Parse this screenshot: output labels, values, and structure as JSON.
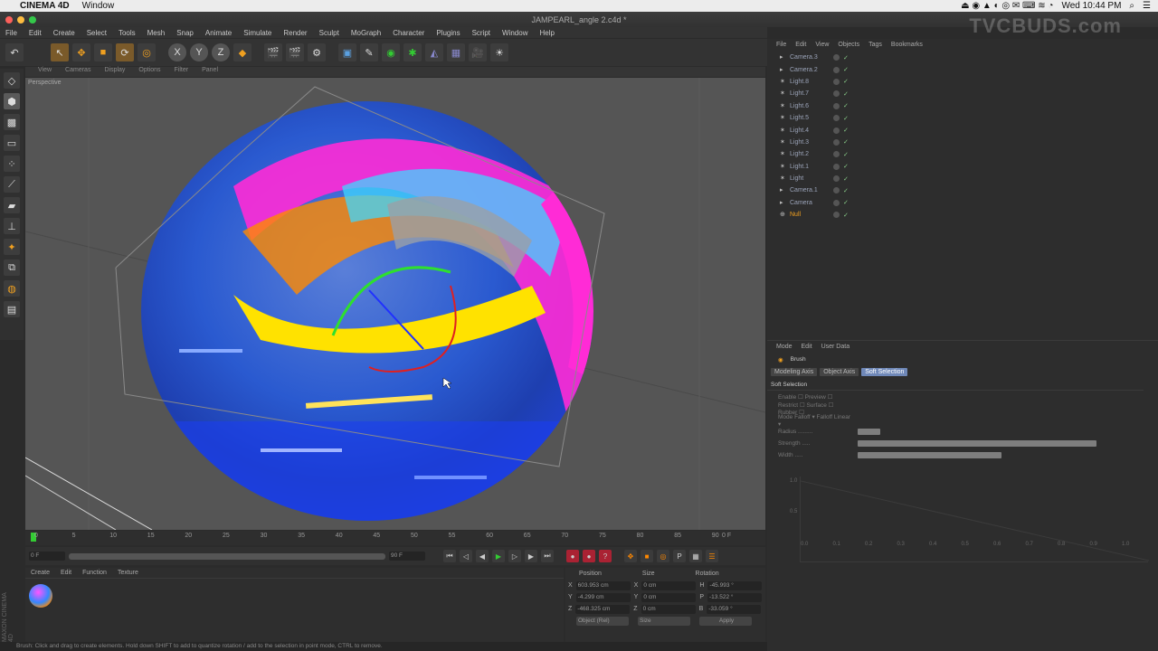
{
  "mac": {
    "apple": "",
    "app": "CINEMA 4D",
    "window": "Window",
    "clock": "Wed 10:44 PM",
    "status_icons": "⏏ ◉ ▲ ◐ ◎ ✉ ⌨ ≋ ◔"
  },
  "window_title": "JAMPEARL_angle 2.c4d *",
  "watermark": "TVCBUDS.com",
  "menubar": [
    "File",
    "Edit",
    "Create",
    "Select",
    "Tools",
    "Mesh",
    "Snap",
    "Animate",
    "Simulate",
    "Render",
    "Sculpt",
    "MoGraph",
    "Character",
    "Plugins",
    "Script",
    "Window",
    "Help"
  ],
  "toolbar": {
    "x": "X",
    "y": "Y",
    "z": "Z"
  },
  "viewport": {
    "menu": [
      "View",
      "Cameras",
      "Display",
      "Options",
      "Filter",
      "Panel"
    ],
    "label": "Perspective"
  },
  "timeline": {
    "ticks": [
      "0",
      "5",
      "10",
      "15",
      "20",
      "25",
      "30",
      "35",
      "40",
      "45",
      "50",
      "55",
      "60",
      "65",
      "70",
      "75",
      "80",
      "85",
      "90"
    ],
    "end": "0 F",
    "start_field": "0 F",
    "end_field": "90 F"
  },
  "material_menu": [
    "Create",
    "Edit",
    "Function",
    "Texture"
  ],
  "coords": {
    "headers": [
      "Position",
      "Size",
      "Rotation"
    ],
    "rows": [
      {
        "axis": "X",
        "pos": "603.953 cm",
        "size_axis": "X",
        "size": "0 cm",
        "rot_axis": "H",
        "rot": "-45.993 °"
      },
      {
        "axis": "Y",
        "pos": "-4.299 cm",
        "size_axis": "Y",
        "size": "0 cm",
        "rot_axis": "P",
        "rot": "-13.522 °"
      },
      {
        "axis": "Z",
        "pos": "-468.325 cm",
        "size_axis": "Z",
        "size": "0 cm",
        "rot_axis": "B",
        "rot": "-33.059 °"
      }
    ],
    "mode": "Object (Rel)",
    "size_mode": "Size",
    "apply": "Apply"
  },
  "statusbar": "Brush: Click and drag to create elements. Hold down SHIFT to add to quantize rotation / add to the selection in point mode, CTRL to remove.",
  "objects_menu": [
    "File",
    "Edit",
    "View",
    "Objects",
    "Tags",
    "Bookmarks"
  ],
  "objects": [
    "Camera.3",
    "Camera.2",
    "Light.8",
    "Light.7",
    "Light.6",
    "Light.5",
    "Light.4",
    "Light.3",
    "Light.2",
    "Light.1",
    "Light",
    "Camera.1",
    "Camera",
    "Null"
  ],
  "attr": {
    "menu": [
      "Mode",
      "Edit",
      "User Data"
    ],
    "tool": "Brush",
    "tabs": [
      "Modeling Axis",
      "Object Axis",
      "Soft Selection"
    ],
    "section": "Soft Selection",
    "rows": [
      "Enable ☐   Preview ☐",
      "Restrict ☐   Surface ☐   Rubber ☐",
      "Mode  Falloff ▾   Falloff  Linear ▾",
      "Radius  .........",
      "Strength  .....",
      "Width  ....."
    ],
    "graph_y": [
      "1.0",
      "0.5"
    ],
    "graph_x": [
      "0.0",
      "0.1",
      "0.2",
      "0.3",
      "0.4",
      "0.5",
      "0.6",
      "0.7",
      "0.8",
      "0.9",
      "1.0"
    ],
    "radius_fill": 0.08,
    "strength_fill": 0.83,
    "width_fill": 0.5
  }
}
